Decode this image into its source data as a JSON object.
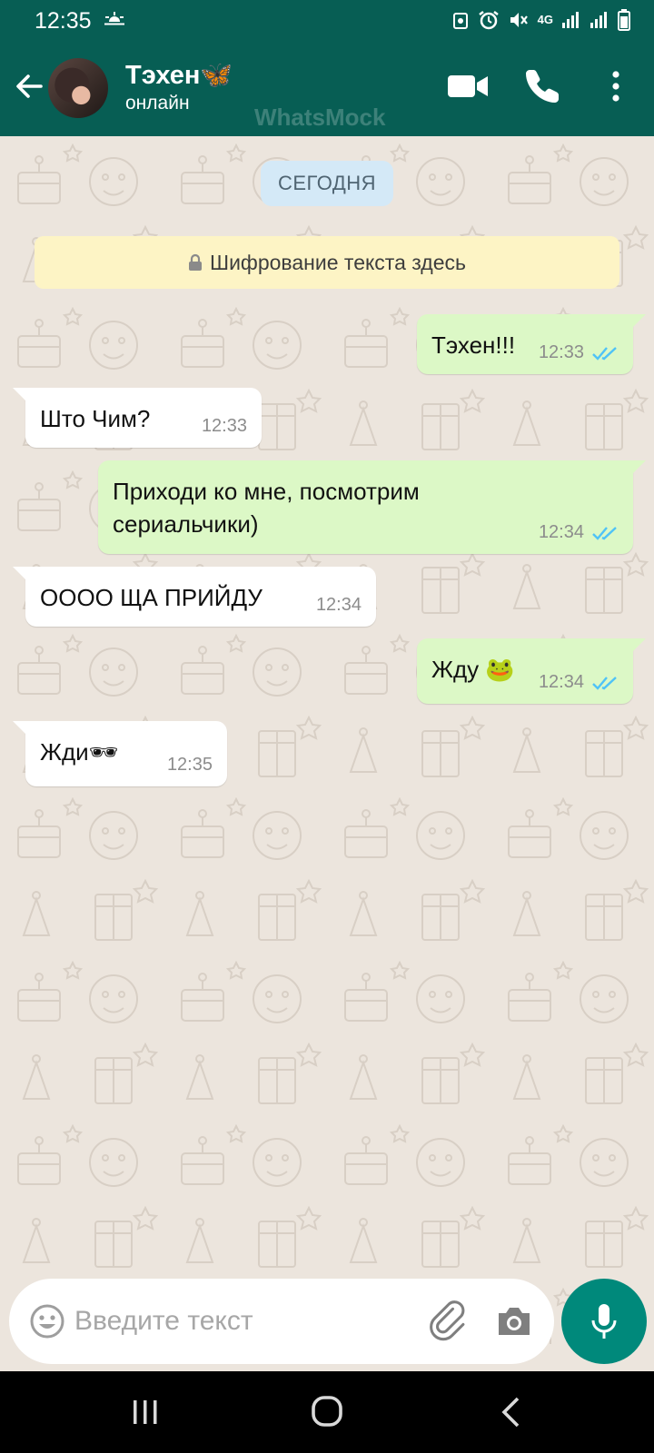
{
  "status_bar": {
    "time": "12:35",
    "network": "4G",
    "icons": [
      "weather-icon",
      "alarm-icon",
      "mute-icon",
      "signal-icon",
      "battery-icon"
    ]
  },
  "header": {
    "contact_name": "Тэхен🦋",
    "contact_status": "онлайн",
    "watermark": "WhatsMock",
    "accent_color": "#075E54"
  },
  "chat": {
    "date_label": "СЕГОДНЯ",
    "encryption_notice": "Шифрование текста здесь",
    "messages": [
      {
        "direction": "out",
        "text": "Тэхен!!!",
        "time": "12:33",
        "status": "read"
      },
      {
        "direction": "in",
        "text": "Што Чим?",
        "time": "12:33"
      },
      {
        "direction": "out",
        "text": "Приходи ко мне, посмотрим\nсериальчики)",
        "time": "12:34",
        "status": "read"
      },
      {
        "direction": "in",
        "text": "ОООО ЩА ПРИЙДУ",
        "time": "12:34"
      },
      {
        "direction": "out",
        "text": "Жду 🐸",
        "time": "12:34",
        "status": "read"
      },
      {
        "direction": "in",
        "text": "Жди🕶",
        "time": "12:35"
      }
    ],
    "outgoing_bubble_color": "#DCF8C6",
    "incoming_bubble_color": "#FFFFFF",
    "read_tick_color": "#4FC3F7"
  },
  "composer": {
    "placeholder": "Введите текст",
    "mic_color": "#00897B"
  }
}
